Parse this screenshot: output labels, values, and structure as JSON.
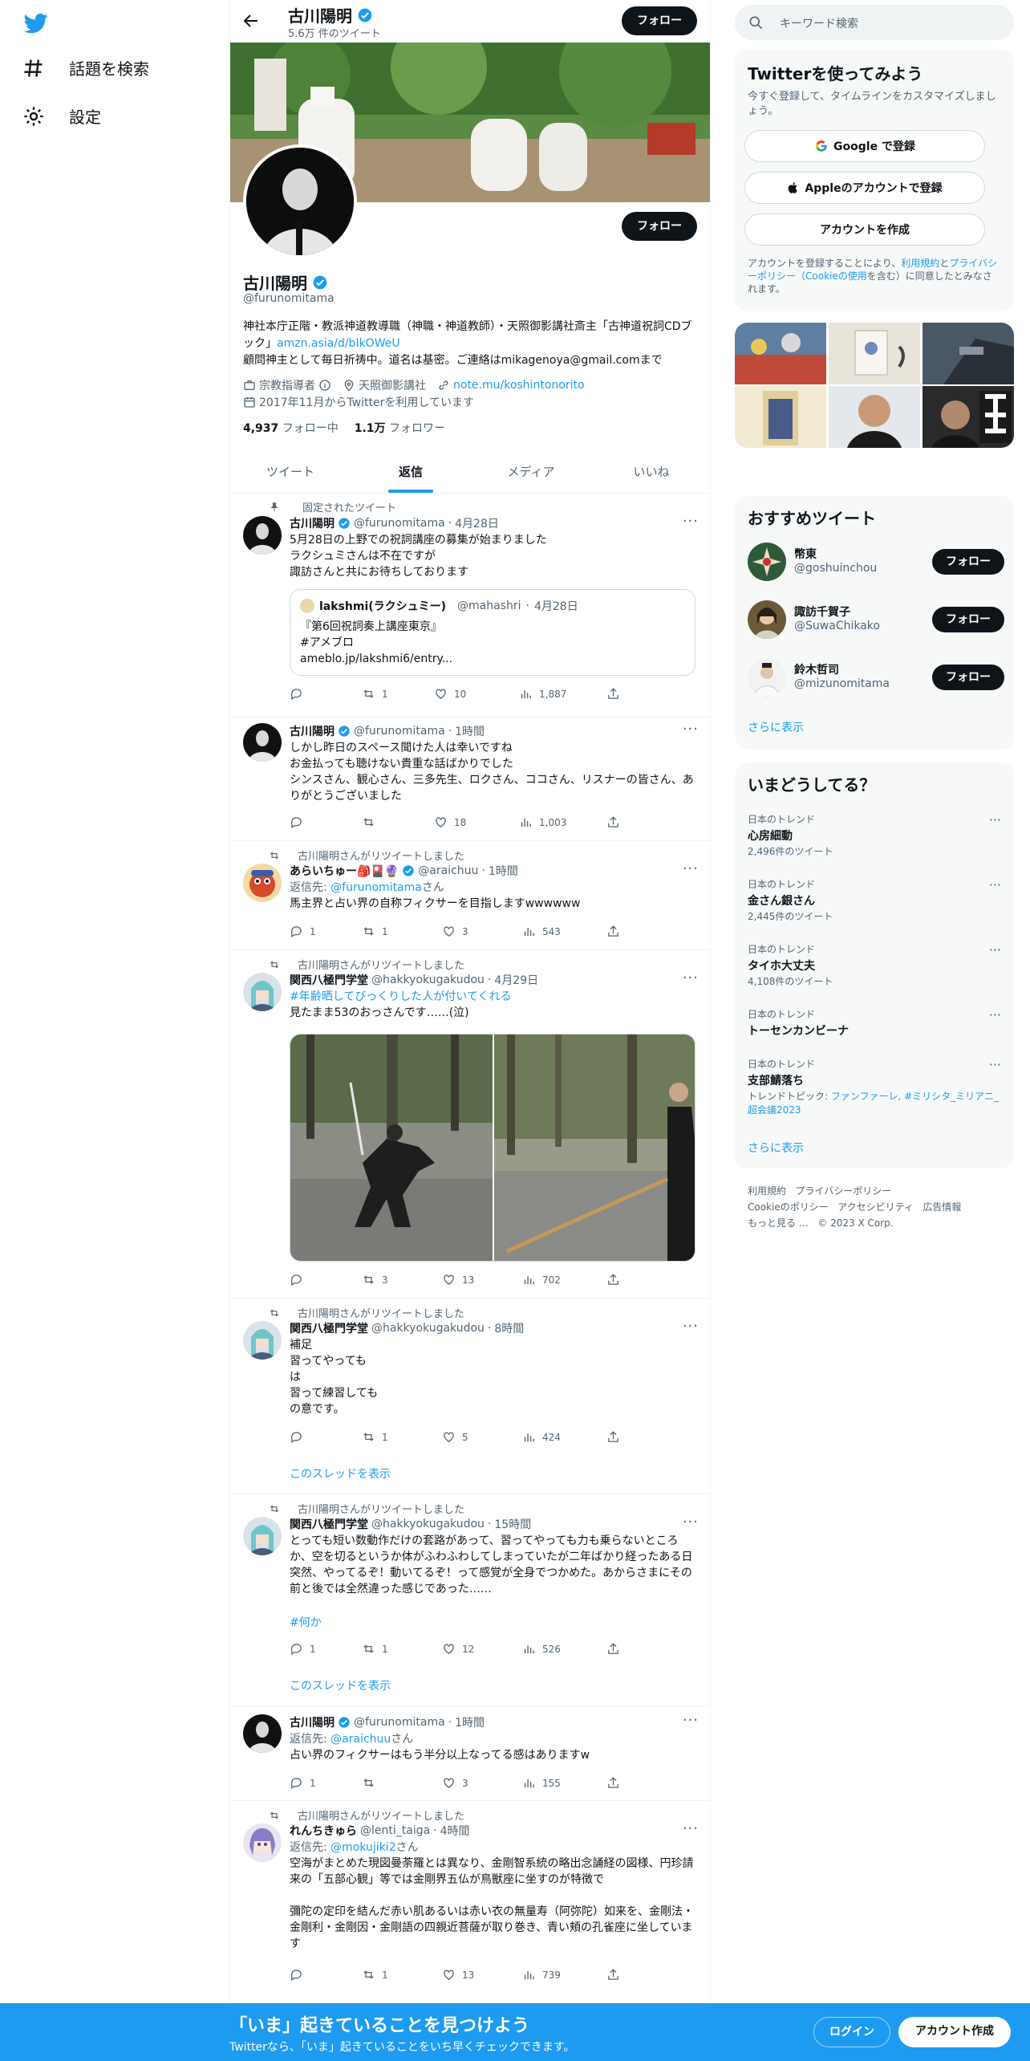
{
  "nav": {
    "explore": "話題を検索",
    "settings": "設定"
  },
  "profile": {
    "name": "古川陽明",
    "tweet_count": "5.6万 件のツイート",
    "follow_label": "フォロー",
    "handle": "@furunomitama",
    "bio_line1": "神社本庁正階・教派神道教導職（神職・神道教師）・天照御影講社斎主「古神道祝詞CDブック」",
    "bio_link": "amzn.asia/d/bIkOWeU",
    "bio_line2": "顧問神主として毎日祈祷中。道名は基密。ご連絡はmikagenoya@gmail.comまで",
    "category": "宗教指導者",
    "location": "天照御影講社",
    "website": "note.mu/koshintonorito",
    "joined": "2017年11月からTwitterを利用しています",
    "following_count": "4,937",
    "following_label": "フォロー中",
    "followers_count": "1.1万",
    "followers_label": "フォロワー"
  },
  "tabs": [
    "ツイート",
    "返信",
    "メディア",
    "いいね"
  ],
  "tweets": [
    {
      "social": "固定されたツイート",
      "name": "古川陽明",
      "handle": "@furunomitama",
      "time": "4月28日",
      "body": "5月28日の上野での祝詞講座の募集が始まりました\nラクシュミさんは不在ですが\n諏訪さんと共にお待ちしております",
      "quote": {
        "name": "lakshmi(ラクシュミー)",
        "handle": "@mahashri",
        "time": "4月28日",
        "body": "『第6回祝詞奏上講座東京』\n#アメブロ\n ameblo.jp/lakshmi6/entry..."
      },
      "replies": "",
      "retweets": "1",
      "likes": "10",
      "views": "1,887"
    },
    {
      "name": "古川陽明",
      "handle": "@furunomitama",
      "time": "1時間",
      "body": "しかし昨日のスペース聞けた人は幸いですね\nお金払っても聴けない貴重な話ばかりでした\nシンスさん、観心さん、三多先生、ロクさん、ココさん、リスナーの皆さん、ありがとうございました",
      "replies": "",
      "retweets": "",
      "likes": "18",
      "views": "1,003"
    },
    {
      "social": "古川陽明さんがリツイートしました",
      "name": "あらいちゅー🎒🎴🔮",
      "handle": "@araichuu",
      "time": "1時間",
      "reply_to_label": "返信先: ",
      "reply_to": "@furunomitama",
      "reply_suffix": "さん",
      "body": "馬主界と占い界の自称フィクサーを目指しますwwwwww",
      "replies": "1",
      "retweets": "1",
      "likes": "3",
      "views": "543"
    },
    {
      "social": "古川陽明さんがリツイートしました",
      "name": "関西八極門学堂",
      "handle": "@hakkyokugakudou",
      "time": "4月29日",
      "hashtag": "#年齢晒してびっくりした人が付いてくれる",
      "body": "見たまま53のおっさんです……(泣)",
      "replies": "",
      "retweets": "3",
      "likes": "13",
      "views": "702"
    },
    {
      "social": "古川陽明さんがリツイートしました",
      "name": "関西八極門学堂",
      "handle": "@hakkyokugakudou",
      "time": "8時間",
      "body": "補足\n習ってやっても\nは\n習って練習しても\nの意です。",
      "replies": "",
      "retweets": "1",
      "likes": "5",
      "views": "424",
      "show_thread": "このスレッドを表示"
    },
    {
      "social": "古川陽明さんがリツイートしました",
      "name": "関西八極門学堂",
      "handle": "@hakkyokugakudou",
      "time": "15時間",
      "body": "とっても短い数動作だけの套路があって、習ってやっても力も乗らないところか、空を切るというか体がふわふわしてしまっていたが二年ばかり経ったある日突然、やってるぞ！動いてるぞ！って感覚が全身でつかめた。あからさまにその前と後では全然違った感じであった……",
      "hashtag": "#何か",
      "replies": "1",
      "retweets": "1",
      "likes": "12",
      "views": "526",
      "show_thread": "このスレッドを表示"
    },
    {
      "name": "古川陽明",
      "handle": "@furunomitama",
      "time": "1時間",
      "reply_to_label": "返信先: ",
      "reply_to": "@araichuu",
      "reply_suffix": "さん",
      "body": "占い界のフィクサーはもう半分以上なってる感はありますw",
      "replies": "1",
      "retweets": "",
      "likes": "3",
      "views": "155"
    },
    {
      "social": "古川陽明さんがリツイートしました",
      "name": "れんちきゅら",
      "handle": "@lenti_taiga",
      "time": "4時間",
      "reply_to_label": "返信先: ",
      "reply_to": "@mokujiki2",
      "reply_suffix": "さん",
      "body": "空海がまとめた現図曼荼羅とは異なり、金剛智系統の略出念誦経の図様、円珍請来の「五部心観」等では金剛界五仏が鳥獣座に坐すのが特徴で\n\n彌陀の定印を結んだ赤い肌あるいは赤い衣の無量寿（阿弥陀）如来を、金剛法・金剛利・金剛因・金剛語の四親近菩薩が取り巻き、青い頬の孔雀座に坐しています",
      "replies": "",
      "retweets": "1",
      "likes": "13",
      "views": "739"
    }
  ],
  "right": {
    "search_placeholder": "キーワード検索",
    "signup": {
      "title": "Twitterを使ってみよう",
      "subtitle": "今すぐ登録して、タイムラインをカスタマイズしましょう。",
      "google": "Google で登録",
      "apple": "Appleのアカウントで登録",
      "create": "アカウントを作成",
      "legal_pre": "アカウントを登録することにより、",
      "legal_terms": "利用規約",
      "legal_and": "と",
      "legal_privacy": "プライバシーポリシー",
      "legal_cookie": "（Cookieの使用",
      "legal_post": "を含む）に同意したとみなされます。"
    },
    "recommend": {
      "title": "おすすめツイート",
      "users": [
        {
          "name": "幣東",
          "handle": "@goshuinchou"
        },
        {
          "name": "諏訪千賀子",
          "handle": "@SuwaChikako"
        },
        {
          "name": "鈴木哲司",
          "handle": "@mizunomitama"
        }
      ],
      "follow": "フォロー",
      "more": "さらに表示"
    },
    "trends": {
      "title": "いまどうしてる？",
      "items": [
        {
          "context": "日本のトレンド",
          "name": "心房細動",
          "stat": "2,496件のツイート"
        },
        {
          "context": "日本のトレンド",
          "name": "金さん銀さん",
          "stat": "2,445件のツイート"
        },
        {
          "context": "日本のトレンド",
          "name": "タイホ大丈夫",
          "stat": "4,108件のツイート"
        },
        {
          "context": "日本のトレンド",
          "name": "トーセンカンビーナ",
          "stat": ""
        },
        {
          "context": "日本のトレンド",
          "name": "支部鯖落ち",
          "stat": "トレンドトピック: ",
          "stat_links": "ファンファーレ, #ミリシタ_ミリアニ_超会議2023"
        }
      ],
      "more": "さらに表示"
    },
    "footer": {
      "terms": "利用規約",
      "privacy": "プライバシーポリシー",
      "cookie": "Cookieのポリシー",
      "accessibility": "アクセシビリティ",
      "ads": "広告情報",
      "more": "もっと見る …",
      "copyright": "© 2023 X Corp."
    }
  },
  "bottom": {
    "title": "「いま」起きていることを見つけよう",
    "subtitle": "Twitterなら、「いま」起きていることをいち早くチェックできます。",
    "login": "ログイン",
    "signup": "アカウント作成"
  }
}
